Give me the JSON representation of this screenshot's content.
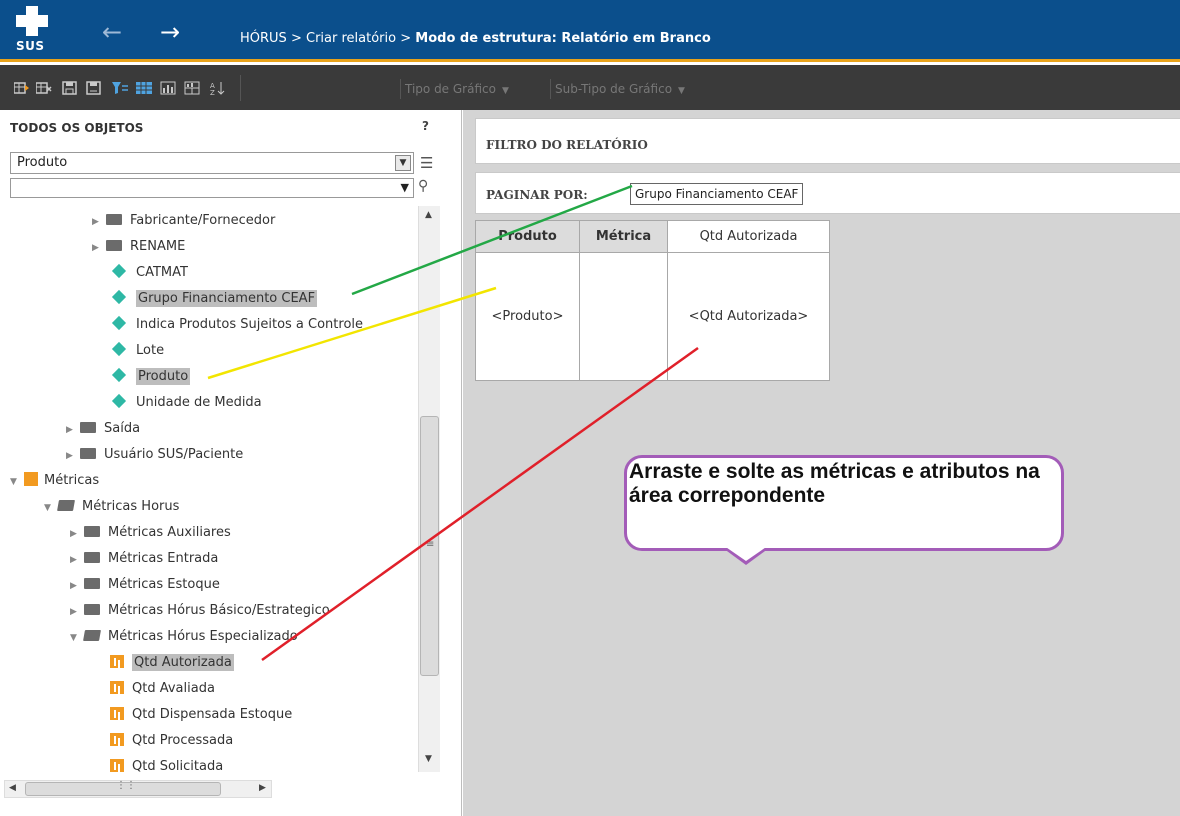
{
  "header": {
    "logo_text": "SUS",
    "breadcrumb": [
      {
        "label": "HÓRUS"
      },
      {
        "label": "Criar relatório"
      },
      {
        "label": "Modo de estrutura: Relatório em Branco"
      }
    ],
    "separator": ">"
  },
  "toolbar": {
    "icons": [
      "report-data-icon",
      "report-data-remove-icon",
      "save-icon",
      "save-as-icon",
      "filter-icon",
      "grid-view-icon",
      "graph-view-icon",
      "grid-graph-icon",
      "sort-icon"
    ],
    "chart_type_label": "Tipo de Gráfico",
    "chart_subtype_label": "Sub-Tipo de Gráfico"
  },
  "objects_panel": {
    "title": "TODOS OS OBJETOS",
    "help_label": "?",
    "selected_object": "Produto",
    "search_value": "",
    "tree": [
      {
        "label": "Fabricante/Fornecedor",
        "kind": "folder"
      },
      {
        "label": "RENAME",
        "kind": "folder"
      },
      {
        "label": "CATMAT",
        "kind": "attribute"
      },
      {
        "label": "Grupo Financiamento CEAF",
        "kind": "attribute",
        "selected": true
      },
      {
        "label": "Indica Produtos Sujeitos a Controle",
        "kind": "attribute"
      },
      {
        "label": "Lote",
        "kind": "attribute"
      },
      {
        "label": "Produto",
        "kind": "attribute",
        "selected": true
      },
      {
        "label": "Unidade de Medida",
        "kind": "attribute"
      },
      {
        "label": "Saída",
        "kind": "folder"
      },
      {
        "label": "Usuário SUS/Paciente",
        "kind": "folder"
      },
      {
        "label": "Métricas",
        "kind": "metric-root"
      },
      {
        "label": "Métricas Horus",
        "kind": "open-folder"
      },
      {
        "label": "Métricas Auxiliares",
        "kind": "folder"
      },
      {
        "label": "Métricas Entrada",
        "kind": "folder"
      },
      {
        "label": "Métricas Estoque",
        "kind": "folder"
      },
      {
        "label": "Métricas Hórus Básico/Estrategico",
        "kind": "folder"
      },
      {
        "label": "Métricas Hórus Especializado",
        "kind": "open-folder"
      },
      {
        "label": "Qtd Autorizada",
        "kind": "metric",
        "selected": true
      },
      {
        "label": "Qtd Avaliada",
        "kind": "metric"
      },
      {
        "label": "Qtd Dispensada Estoque",
        "kind": "metric"
      },
      {
        "label": "Qtd Processada",
        "kind": "metric"
      },
      {
        "label": "Qtd Solicitada",
        "kind": "metric"
      }
    ]
  },
  "report": {
    "filter_title": "FILTRO DO RELATÓRIO",
    "page_by_title": "PAGINAR POR:",
    "page_by_item": "Grupo Financiamento CEAF",
    "grid_headers": [
      "Produto",
      "Métrica",
      "Qtd Autorizada"
    ],
    "grid_cells": [
      "<Produto>",
      "",
      "<Qtd Autorizada>"
    ]
  },
  "annotation": {
    "callout_text": "Arraste e solte as métricas e atributos na área correpondente",
    "line_colors": {
      "green": "#23a846",
      "yellow": "#f2e500",
      "red": "#e0202a"
    },
    "callout_border": "#a35cb8"
  },
  "colors": {
    "header_bg": "#0b4f8c",
    "toolbar_bg": "#3a3a3a",
    "attribute_icon": "#2eb8a5",
    "metric_icon": "#f29a20"
  }
}
